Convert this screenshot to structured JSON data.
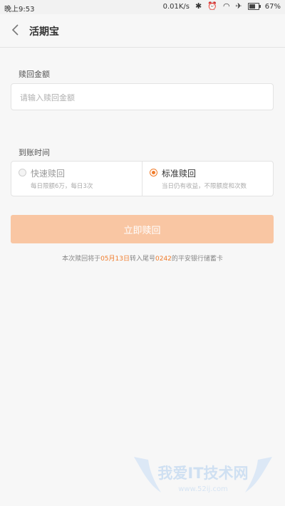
{
  "status_bar": {
    "time": "晚上9:53",
    "speed": "0.01K/s",
    "battery": "67%",
    "battery_level": 0.67,
    "icons": [
      "bluetooth-icon",
      "alarm-icon",
      "wifi-icon",
      "airplane-icon",
      "battery-icon"
    ]
  },
  "header": {
    "title": "活期宝"
  },
  "amount": {
    "label": "赎回金额",
    "placeholder": "请输入赎回金额",
    "value": ""
  },
  "arrival": {
    "label": "到账时间",
    "options": [
      {
        "title": "快速赎回",
        "desc": "每日限额6万，每日3次",
        "selected": false
      },
      {
        "title": "标准赎回",
        "desc": "当日仍有收益，不限额度和次数",
        "selected": true
      }
    ]
  },
  "confirm_label": "立即赎回",
  "note": {
    "prefix": "本次赎回将于",
    "date": "05月13日",
    "middle": "转入尾号",
    "card": "0242",
    "suffix": "的平安银行储蓄卡"
  },
  "watermark": {
    "text": "我爱IT技术网",
    "url": "www.52ij.com"
  },
  "colors": {
    "accent": "#f07b2a",
    "button": "#f9c6a3",
    "background": "#f7f7f7"
  }
}
